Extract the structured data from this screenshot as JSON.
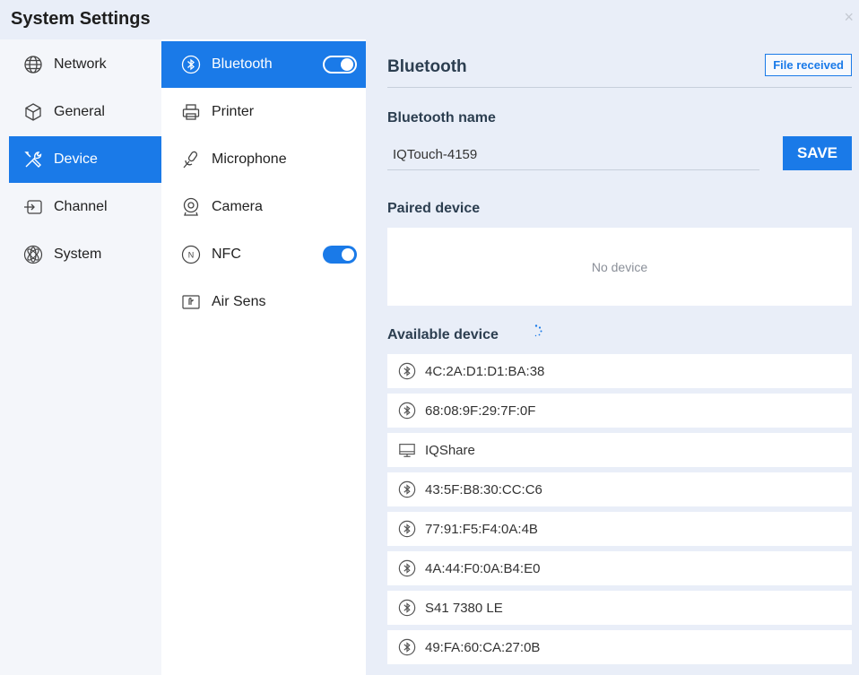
{
  "window": {
    "title": "System Settings",
    "close_glyph": "×"
  },
  "nav": {
    "items": [
      {
        "label": "Network",
        "icon": "globe-icon"
      },
      {
        "label": "General",
        "icon": "cube-icon"
      },
      {
        "label": "Device",
        "icon": "tools-icon",
        "active": true
      },
      {
        "label": "Channel",
        "icon": "input-arrow-icon"
      },
      {
        "label": "System",
        "icon": "atom-icon"
      }
    ]
  },
  "subnav": {
    "items": [
      {
        "label": "Bluetooth",
        "icon": "bluetooth-icon",
        "active": true,
        "toggle": "on"
      },
      {
        "label": "Printer",
        "icon": "printer-icon"
      },
      {
        "label": "Microphone",
        "icon": "microphone-icon"
      },
      {
        "label": "Camera",
        "icon": "camera-icon"
      },
      {
        "label": "NFC",
        "icon": "nfc-icon",
        "toggle": "on"
      },
      {
        "label": "Air Sens",
        "icon": "air-sensor-icon"
      }
    ]
  },
  "bluetooth": {
    "title": "Bluetooth",
    "file_received": "File received",
    "name_heading": "Bluetooth name",
    "name_value": "IQTouch-4159",
    "save_label": "SAVE",
    "paired_heading": "Paired device",
    "paired_empty": "No device",
    "available_heading": "Available device",
    "devices": [
      {
        "label": "4C:2A:D1:D1:BA:38",
        "icon": "bluetooth-icon"
      },
      {
        "label": "68:08:9F:29:7F:0F",
        "icon": "bluetooth-icon"
      },
      {
        "label": "IQShare",
        "icon": "monitor-icon"
      },
      {
        "label": "43:5F:B8:30:CC:C6",
        "icon": "bluetooth-icon"
      },
      {
        "label": "77:91:F5:F4:0A:4B",
        "icon": "bluetooth-icon"
      },
      {
        "label": "4A:44:F0:0A:B4:E0",
        "icon": "bluetooth-icon"
      },
      {
        "label": "S41 7380 LE",
        "icon": "bluetooth-icon"
      },
      {
        "label": "49:FA:60:CA:27:0B",
        "icon": "bluetooth-icon"
      }
    ]
  },
  "colors": {
    "accent": "#1a7ae8",
    "pane_bg": "#e9eef8",
    "nav_bg": "#f4f6fa"
  }
}
